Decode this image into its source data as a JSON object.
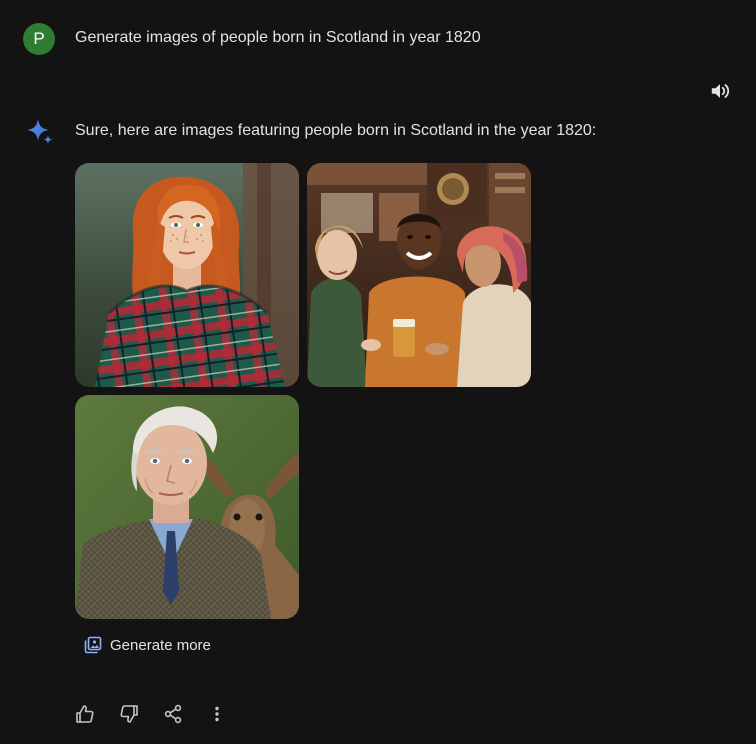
{
  "user": {
    "avatar_initial": "P",
    "prompt": "Generate images of people born in Scotland in year 1820"
  },
  "response": {
    "text": "Sure, here are images featuring people born in Scotland in the year 1820:",
    "images": [
      "portrait-red-haired-woman-tartan-shawl",
      "group-laughing-in-pub",
      "elderly-man-in-tweed-with-deer"
    ],
    "generate_more_label": "Generate more"
  },
  "icons": {
    "speaker": "volume-up-icon",
    "gemini": "gemini-sparkle-icon",
    "generate_more": "photo-library-icon",
    "thumbs_up": "thumb-up-icon",
    "thumbs_down": "thumb-down-icon",
    "share": "share-icon",
    "more": "more-vert-icon"
  },
  "colors": {
    "background": "#131314",
    "text": "#e3e3e3",
    "avatar_bg": "#2e7d32",
    "gemini_blue": "#4285f4"
  }
}
